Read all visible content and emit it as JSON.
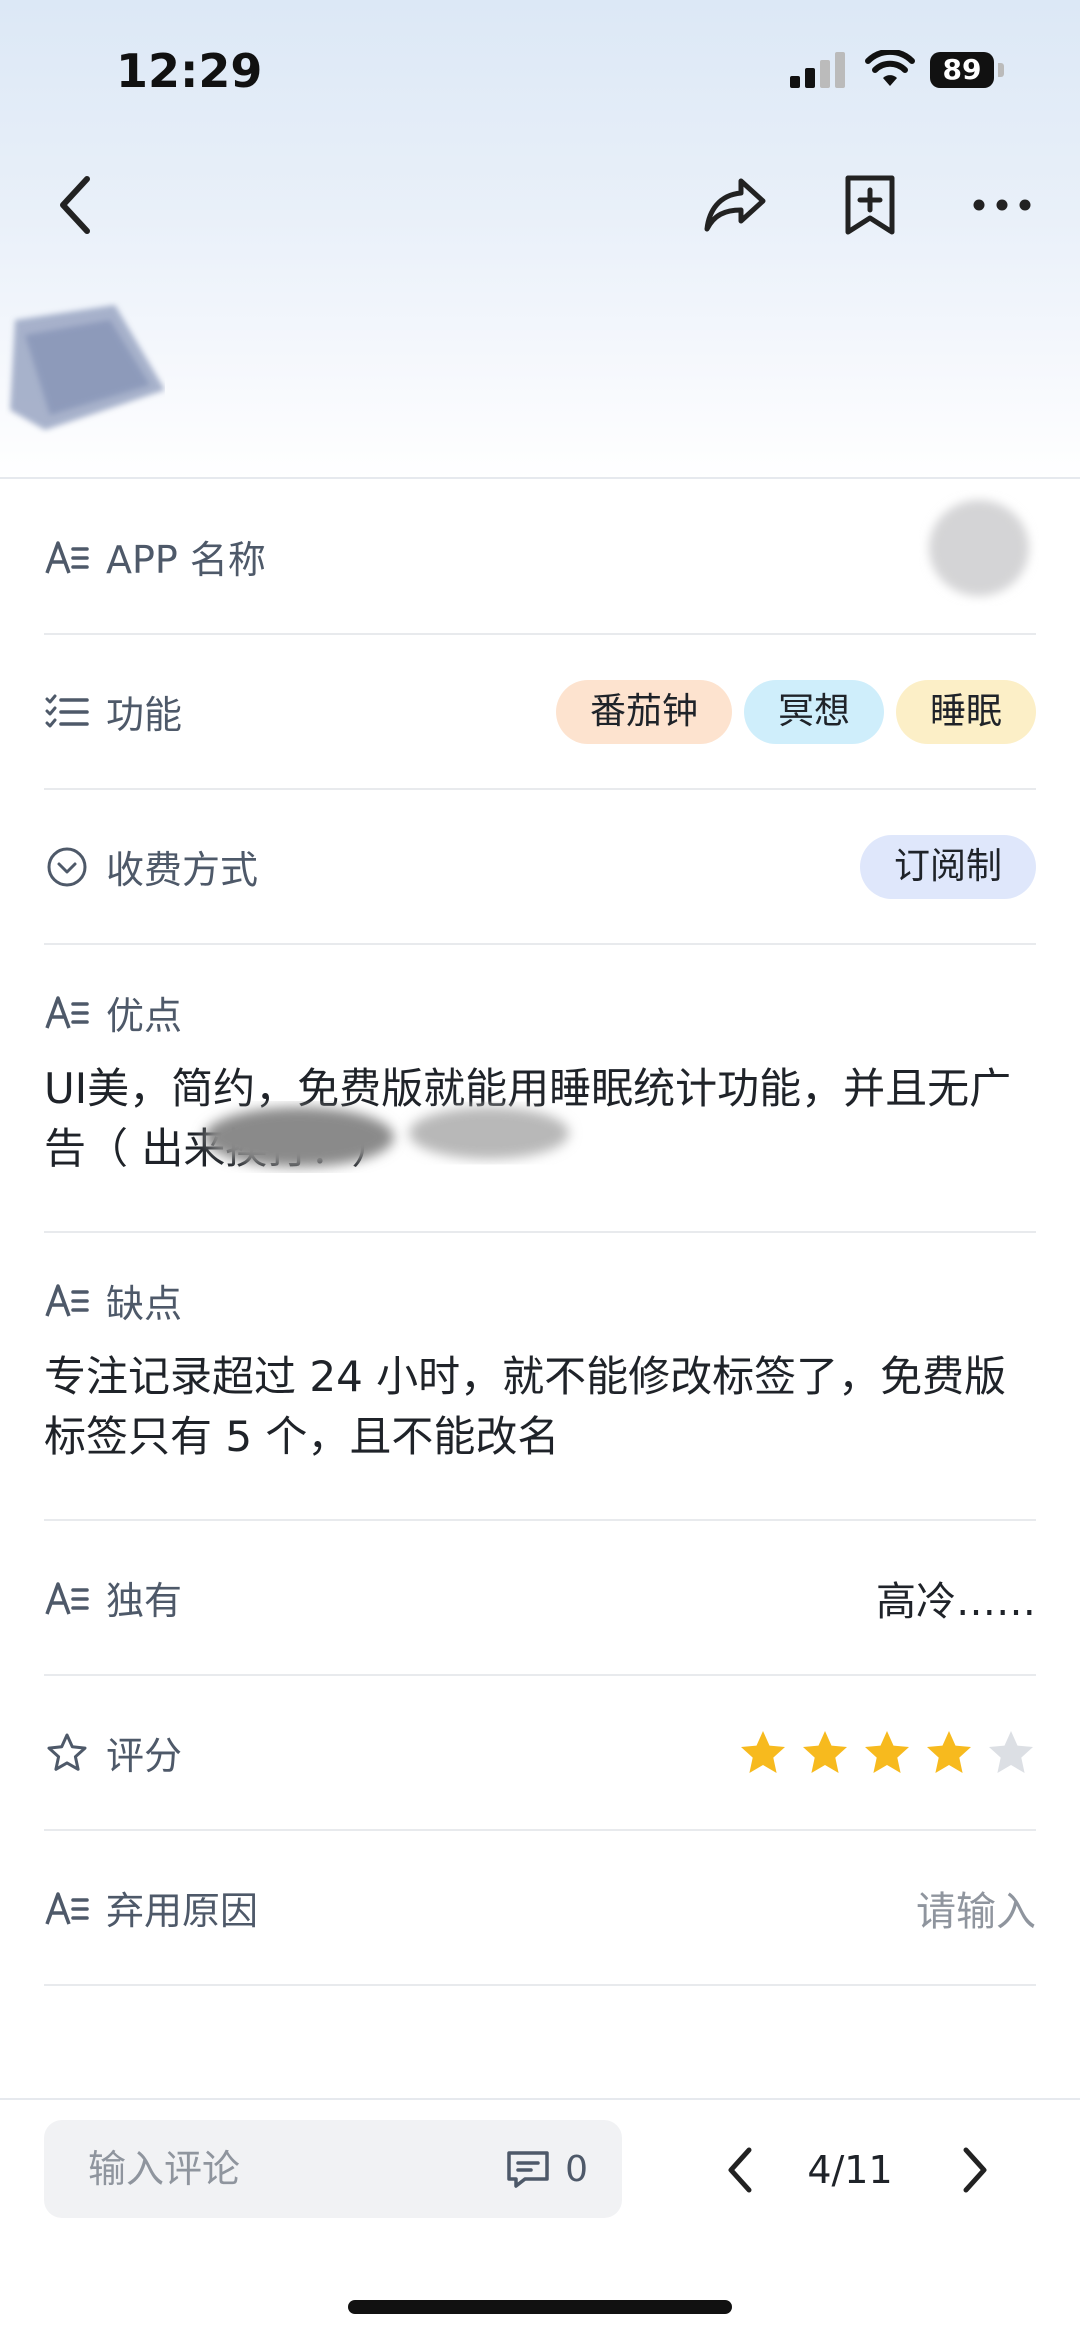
{
  "status_bar": {
    "time": "12:29",
    "battery": "89"
  },
  "fields": {
    "app_name": {
      "label": "APP 名称"
    },
    "features": {
      "label": "功能",
      "tags": [
        "番茄钟",
        "冥想",
        "睡眠"
      ]
    },
    "payment": {
      "label": "收费方式",
      "value": "订阅制"
    },
    "pros": {
      "label": "优点",
      "text": "UI美，简约，免费版就能用睡眠统计功能，并且无广告（                    出来挨打！）"
    },
    "cons": {
      "label": "缺点",
      "text": "专注记录超过 24 小时，就不能修改标签了，免费版标签只有 5 个，且不能改名"
    },
    "unique": {
      "label": "独有",
      "value": "高冷……"
    },
    "rating": {
      "label": "评分",
      "stars": 4,
      "max": 5
    },
    "abandon_reason": {
      "label": "弃用原因",
      "placeholder": "请输入"
    }
  },
  "bottom_bar": {
    "comment_placeholder": "输入评论",
    "comment_count": "0",
    "pager": "4/11"
  },
  "colors": {
    "star_on": "#f7ba1e",
    "star_off": "#dcdfe4",
    "accent_text": "#1f2329",
    "secondary_text": "#4e5969"
  }
}
